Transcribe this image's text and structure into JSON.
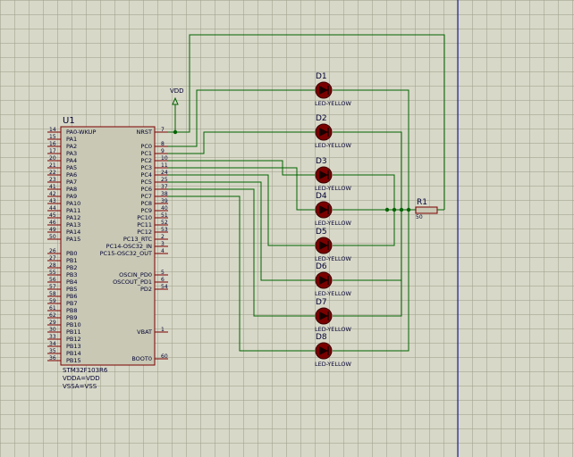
{
  "colors": {
    "background": "#d8d8c8",
    "grid": "#a0a08c",
    "wire": "#006400",
    "chip_fill": "#c8c8b4",
    "chip_border": "#7a0000",
    "pin_line": "#7a0000",
    "led_body": "#7a0000",
    "text": "#000033",
    "boundary_line": "#0000a0"
  },
  "chip": {
    "ref": "U1",
    "part": "STM32F103R6",
    "notes": [
      "VDDA=VDD",
      "VSSA=VSS"
    ],
    "left_pins": [
      {
        "num": "14",
        "name": "PA0-WKUP"
      },
      {
        "num": "15",
        "name": "PA1"
      },
      {
        "num": "16",
        "name": "PA2"
      },
      {
        "num": "17",
        "name": "PA3"
      },
      {
        "num": "20",
        "name": "PA4"
      },
      {
        "num": "21",
        "name": "PA5"
      },
      {
        "num": "22",
        "name": "PA6"
      },
      {
        "num": "23",
        "name": "PA7"
      },
      {
        "num": "41",
        "name": "PA8"
      },
      {
        "num": "42",
        "name": "PA9"
      },
      {
        "num": "43",
        "name": "PA10"
      },
      {
        "num": "44",
        "name": "PA11"
      },
      {
        "num": "45",
        "name": "PA12"
      },
      {
        "num": "46",
        "name": "PA13"
      },
      {
        "num": "49",
        "name": "PA14"
      },
      {
        "num": "50",
        "name": "PA15"
      },
      {
        "num": "26",
        "name": "PB0"
      },
      {
        "num": "27",
        "name": "PB1"
      },
      {
        "num": "28",
        "name": "PB2"
      },
      {
        "num": "55",
        "name": "PB3"
      },
      {
        "num": "56",
        "name": "PB4"
      },
      {
        "num": "57",
        "name": "PB5"
      },
      {
        "num": "58",
        "name": "PB6"
      },
      {
        "num": "59",
        "name": "PB7"
      },
      {
        "num": "61",
        "name": "PB8"
      },
      {
        "num": "62",
        "name": "PB9"
      },
      {
        "num": "29",
        "name": "PB10"
      },
      {
        "num": "30",
        "name": "PB11"
      },
      {
        "num": "33",
        "name": "PB12"
      },
      {
        "num": "34",
        "name": "PB13"
      },
      {
        "num": "35",
        "name": "PB14"
      },
      {
        "num": "36",
        "name": "PB15"
      }
    ],
    "right_pins": [
      {
        "num": "7",
        "name": "NRST"
      },
      {
        "num": "8",
        "name": "PC0"
      },
      {
        "num": "9",
        "name": "PC1"
      },
      {
        "num": "10",
        "name": "PC2"
      },
      {
        "num": "11",
        "name": "PC3"
      },
      {
        "num": "24",
        "name": "PC4"
      },
      {
        "num": "25",
        "name": "PC5"
      },
      {
        "num": "37",
        "name": "PC6"
      },
      {
        "num": "38",
        "name": "PC7"
      },
      {
        "num": "39",
        "name": "PC8"
      },
      {
        "num": "40",
        "name": "PC9"
      },
      {
        "num": "51",
        "name": "PC10"
      },
      {
        "num": "52",
        "name": "PC11"
      },
      {
        "num": "53",
        "name": "PC12"
      },
      {
        "num": "2",
        "name": "PC13_RTC"
      },
      {
        "num": "3",
        "name": "PC14-OSC32_IN"
      },
      {
        "num": "4",
        "name": "PC15-OSC32_OUT"
      },
      {
        "num": "5",
        "name": "OSCIN_PD0"
      },
      {
        "num": "6",
        "name": "OSCOUT_PD1"
      },
      {
        "num": "54",
        "name": "PD2"
      },
      {
        "num": "1",
        "name": "VBAT"
      },
      {
        "num": "60",
        "name": "BOOT0"
      }
    ]
  },
  "power": {
    "label": "VDD"
  },
  "leds": [
    {
      "ref": "D1",
      "type": "LED-YELLOW"
    },
    {
      "ref": "D2",
      "type": "LED-YELLOW"
    },
    {
      "ref": "D3",
      "type": "LED-YELLOW"
    },
    {
      "ref": "D4",
      "type": "LED-YELLOW"
    },
    {
      "ref": "D5",
      "type": "LED-YELLOW"
    },
    {
      "ref": "D6",
      "type": "LED-YELLOW"
    },
    {
      "ref": "D7",
      "type": "LED-YELLOW"
    },
    {
      "ref": "D8",
      "type": "LED-YELLOW"
    }
  ],
  "resistor": {
    "ref": "R1",
    "value": "50"
  }
}
